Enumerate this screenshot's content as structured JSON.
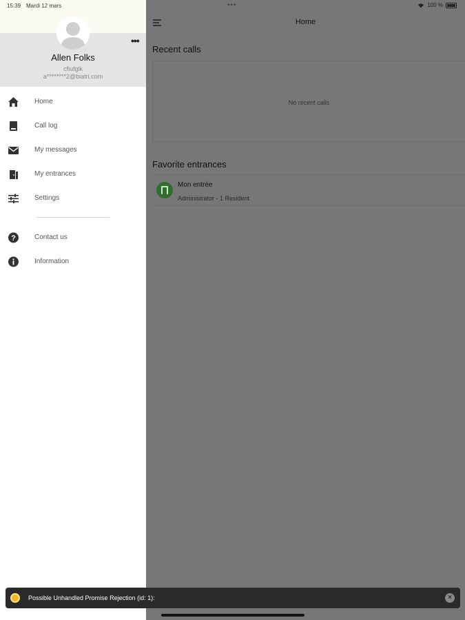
{
  "status_bar": {
    "time": "15:39",
    "date": "Mardi 12 mars",
    "battery": "100 %"
  },
  "drawer": {
    "user": {
      "name": "Allen Folks",
      "id": "cfiufglk",
      "email": "a********2@biatri.com"
    },
    "items": [
      {
        "label": "Home",
        "icon": "home-icon"
      },
      {
        "label": "Call log",
        "icon": "book-icon"
      },
      {
        "label": "My messages",
        "icon": "envelope-icon"
      },
      {
        "label": "My entrances",
        "icon": "door-icon"
      },
      {
        "label": "Settings",
        "icon": "sliders-icon"
      }
    ],
    "secondary_items": [
      {
        "label": "Contact us",
        "icon": "help-icon"
      },
      {
        "label": "Information",
        "icon": "info-icon"
      }
    ]
  },
  "main": {
    "title": "Home",
    "recent_calls": {
      "title": "Recent calls",
      "empty_text": "No recent calls"
    },
    "favorites": {
      "title": "Favorite entrances",
      "items": [
        {
          "name": "Mon entrée",
          "subtitle": "Administrator - 1 Resident"
        }
      ]
    }
  },
  "toast": {
    "message": "Possible Unhandled Promise Rejection (id: 1):"
  },
  "colors": {
    "drawer_bg": "#ffffff",
    "header_bg": "#e4e4e4",
    "overlay": "#777777",
    "favorite_avatar": "#2f6e2f",
    "toast_bg": "#2a2a2a"
  }
}
